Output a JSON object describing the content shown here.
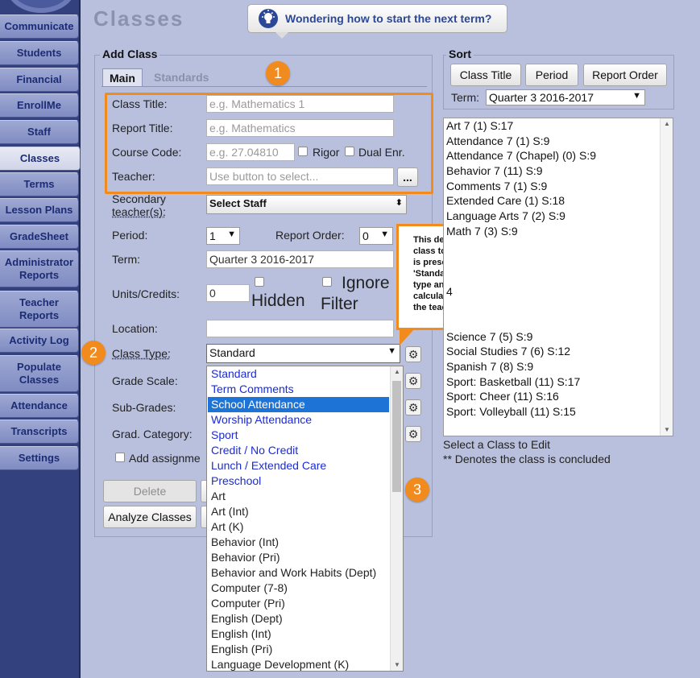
{
  "sidebar": {
    "items": [
      {
        "label": "Communicate"
      },
      {
        "label": "Students"
      },
      {
        "label": "Financial"
      },
      {
        "label": "EnrollMe"
      },
      {
        "label": "Staff"
      },
      {
        "label": "Classes",
        "active": true
      },
      {
        "label": "Terms"
      },
      {
        "label": "Lesson Plans"
      },
      {
        "label": "GradeSheet"
      },
      {
        "label": "Administrator Reports"
      },
      {
        "label": "Teacher Reports"
      },
      {
        "label": "Activity Log"
      },
      {
        "label": "Populate Classes"
      },
      {
        "label": "Attendance"
      },
      {
        "label": "Transcripts"
      },
      {
        "label": "Settings"
      }
    ]
  },
  "header": {
    "title": "Classes",
    "tip_button": "Wondering how to start the next term?"
  },
  "add_class": {
    "title": "Add Class",
    "tabs": {
      "main": "Main",
      "standards": "Standards"
    },
    "class_title": {
      "label": "Class Title:",
      "placeholder": "e.g. Mathematics 1"
    },
    "report_title": {
      "label": "Report Title:",
      "placeholder": "e.g. Mathematics"
    },
    "course_code": {
      "label": "Course Code:",
      "placeholder": "e.g. 27.04810"
    },
    "rigor_label": "Rigor",
    "dual_label": "Dual Enr.",
    "teacher": {
      "label": "Teacher:",
      "placeholder": "Use button to select...",
      "button": "..."
    },
    "secondary_teacher": {
      "label_line1": "Secondary",
      "label_line2": "teacher(s):",
      "value": "Select Staff"
    },
    "period": {
      "label": "Period:",
      "value": "1"
    },
    "report_order": {
      "label": "Report Order:",
      "value": "0"
    },
    "term": {
      "label": "Term:",
      "value": "Quarter 3 2016-2017"
    },
    "units": {
      "label": "Units/Credits:",
      "value": "0"
    },
    "hidden_label": "Hidden",
    "ignore_filter_line1": "Ignore",
    "ignore_filter_line2": "Filter",
    "location": {
      "label": "Location:",
      "value": ""
    },
    "class_type": {
      "label": "Class Type:",
      "value": "Standard"
    },
    "grade_scale_label": "Grade Scale:",
    "sub_grades_label": "Sub-Grades:",
    "grad_category_label": "Grad. Category:",
    "add_assignments_label": "Add assignme",
    "delete_button": "Delete",
    "analyze_button": "Analyze Classes"
  },
  "class_type_options": [
    {
      "label": "Standard",
      "kind": "group"
    },
    {
      "label": "Term Comments",
      "kind": "group"
    },
    {
      "label": "School Attendance",
      "kind": "selected"
    },
    {
      "label": "Worship Attendance",
      "kind": "group"
    },
    {
      "label": "Sport",
      "kind": "group"
    },
    {
      "label": "Credit / No Credit",
      "kind": "group"
    },
    {
      "label": "Lunch / Extended Care",
      "kind": "group"
    },
    {
      "label": "Preschool",
      "kind": "group"
    },
    {
      "label": "Art",
      "kind": "plain"
    },
    {
      "label": "Art (Int)",
      "kind": "plain"
    },
    {
      "label": "Art (K)",
      "kind": "plain"
    },
    {
      "label": "Behavior (Int)",
      "kind": "plain"
    },
    {
      "label": "Behavior (Pri)",
      "kind": "plain"
    },
    {
      "label": "Behavior and Work Habits (Dept)",
      "kind": "plain"
    },
    {
      "label": "Computer (7-8)",
      "kind": "plain"
    },
    {
      "label": "Computer (Pri)",
      "kind": "plain"
    },
    {
      "label": "English (Dept)",
      "kind": "plain"
    },
    {
      "label": "English (Int)",
      "kind": "plain"
    },
    {
      "label": "English (Pri)",
      "kind": "plain"
    },
    {
      "label": "Language Development (K)",
      "kind": "plain"
    }
  ],
  "callout": {
    "text": "This determines the type of class to be created and what is presented to the teacher. 'Standard' is your typical type and this provides a calculated Grade Sheet to the teacher."
  },
  "badges": {
    "one": "1",
    "two": "2",
    "three": "3"
  },
  "sort": {
    "title": "Sort",
    "buttons": {
      "class_title": "Class Title",
      "period": "Period",
      "report_order": "Report Order"
    },
    "term_label": "Term:",
    "term_value": "Quarter 3 2016-2017",
    "classes": [
      "Art 7 (1) S:17",
      "Attendance 7 (1) S:9",
      "Attendance 7 (Chapel) (0) S:9",
      "Behavior 7 (11) S:9",
      "Comments 7 (1) S:9",
      "Extended Care (1) S:18",
      "Language Arts 7 (2) S:9",
      "Math 7 (3) S:9",
      "",
      "",
      "",
      "4",
      "",
      "",
      "Science 7 (5) S:9",
      "Social Studies 7 (6) S:12",
      "Spanish 7 (8) S:9",
      "Sport: Basketball (11) S:17",
      "Sport: Cheer (11) S:16",
      "Sport: Volleyball (11) S:15"
    ],
    "hint1": "Select a Class to Edit",
    "hint2": "** Denotes the class is concluded"
  },
  "colors": {
    "accent": "#f28b1e",
    "sidebar": "#33427e",
    "link": "#1b2bd6",
    "selected": "#1e73d6"
  }
}
